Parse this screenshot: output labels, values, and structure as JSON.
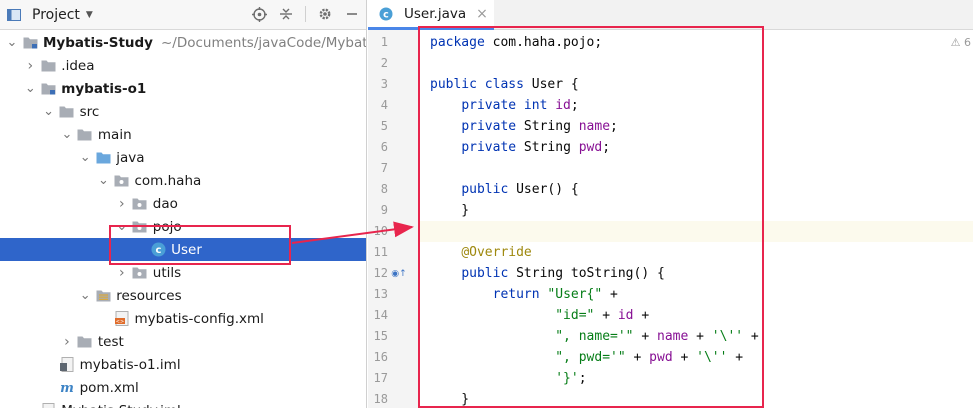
{
  "project_panel": {
    "title": "Project",
    "tree": [
      {
        "label": "Mybatis-Study",
        "path": "~/Documents/javaCode/Mybatis-Study",
        "icon": "module-folder-icon",
        "expanded": true,
        "bold": true
      },
      {
        "label": ".idea",
        "icon": "folder-icon",
        "expanded": false
      },
      {
        "label": "mybatis-o1",
        "icon": "module-folder-icon",
        "expanded": true,
        "bold": true
      },
      {
        "label": "src",
        "icon": "folder-icon",
        "expanded": true
      },
      {
        "label": "main",
        "icon": "folder-icon",
        "expanded": true
      },
      {
        "label": "java",
        "icon": "source-folder-icon",
        "expanded": true
      },
      {
        "label": "com.haha",
        "icon": "package-icon",
        "expanded": true
      },
      {
        "label": "dao",
        "icon": "package-icon",
        "expanded": false
      },
      {
        "label": "pojo",
        "icon": "package-icon",
        "expanded": true
      },
      {
        "label": "User",
        "icon": "class-icon",
        "selected": true
      },
      {
        "label": "utils",
        "icon": "package-icon",
        "expanded": false
      },
      {
        "label": "resources",
        "icon": "resources-folder-icon",
        "expanded": true
      },
      {
        "label": "mybatis-config.xml",
        "icon": "xml-file-icon"
      },
      {
        "label": "test",
        "icon": "folder-icon",
        "expanded": false
      },
      {
        "label": "mybatis-o1.iml",
        "icon": "iml-file-icon"
      },
      {
        "label": "pom.xml",
        "icon": "maven-file-icon"
      },
      {
        "label": "Mybatis-Study.iml",
        "icon": "iml-file-icon"
      }
    ]
  },
  "editor": {
    "tab_label": "User.java",
    "warning_count": "6",
    "line_numbers": [
      "1",
      "2",
      "3",
      "4",
      "5",
      "6",
      "7",
      "8",
      "9",
      "10",
      "11",
      "12",
      "13",
      "14",
      "15",
      "16",
      "17",
      "18"
    ],
    "lines": [
      [
        {
          "t": "package",
          "c": "kw"
        },
        {
          "t": " com.haha.pojo;"
        }
      ],
      [],
      [
        {
          "t": "public class",
          "c": "kw"
        },
        {
          "t": " User {"
        }
      ],
      [
        {
          "t": "    "
        },
        {
          "t": "private int",
          "c": "kw"
        },
        {
          "t": " "
        },
        {
          "t": "id",
          "c": "fld"
        },
        {
          "t": ";"
        }
      ],
      [
        {
          "t": "    "
        },
        {
          "t": "private",
          "c": "kw"
        },
        {
          "t": " String "
        },
        {
          "t": "name",
          "c": "fld"
        },
        {
          "t": ";"
        }
      ],
      [
        {
          "t": "    "
        },
        {
          "t": "private",
          "c": "kw"
        },
        {
          "t": " String "
        },
        {
          "t": "pwd",
          "c": "fld"
        },
        {
          "t": ";"
        }
      ],
      [],
      [
        {
          "t": "    "
        },
        {
          "t": "public",
          "c": "kw"
        },
        {
          "t": " User() {"
        }
      ],
      [
        {
          "t": "    }"
        }
      ],
      [],
      [
        {
          "t": "    "
        },
        {
          "t": "@Override",
          "c": "ann"
        }
      ],
      [
        {
          "t": "    "
        },
        {
          "t": "public",
          "c": "kw"
        },
        {
          "t": " String toString() {"
        }
      ],
      [
        {
          "t": "        "
        },
        {
          "t": "return",
          "c": "kw"
        },
        {
          "t": " "
        },
        {
          "t": "\"User{\"",
          "c": "str"
        },
        {
          "t": " +"
        }
      ],
      [
        {
          "t": "                "
        },
        {
          "t": "\"id=\"",
          "c": "str"
        },
        {
          "t": " + "
        },
        {
          "t": "id",
          "c": "fld"
        },
        {
          "t": " +"
        }
      ],
      [
        {
          "t": "                "
        },
        {
          "t": "\", name='\"",
          "c": "str"
        },
        {
          "t": " + "
        },
        {
          "t": "name",
          "c": "fld"
        },
        {
          "t": " + "
        },
        {
          "t": "'\\''",
          "c": "str"
        },
        {
          "t": " +"
        }
      ],
      [
        {
          "t": "                "
        },
        {
          "t": "\", pwd='\"",
          "c": "str"
        },
        {
          "t": " + "
        },
        {
          "t": "pwd",
          "c": "fld"
        },
        {
          "t": " + "
        },
        {
          "t": "'\\''",
          "c": "str"
        },
        {
          "t": " +"
        }
      ],
      [
        {
          "t": "                "
        },
        {
          "t": "'}'",
          "c": "str"
        },
        {
          "t": ";"
        }
      ],
      [
        {
          "t": "    }"
        }
      ]
    ],
    "current_line": 10
  },
  "colors": {
    "selection": "#2f65ca",
    "highlight_box": "#e8254d",
    "keyword": "#0033b3",
    "field": "#871094",
    "string": "#067d17",
    "annotation": "#9e880d"
  }
}
